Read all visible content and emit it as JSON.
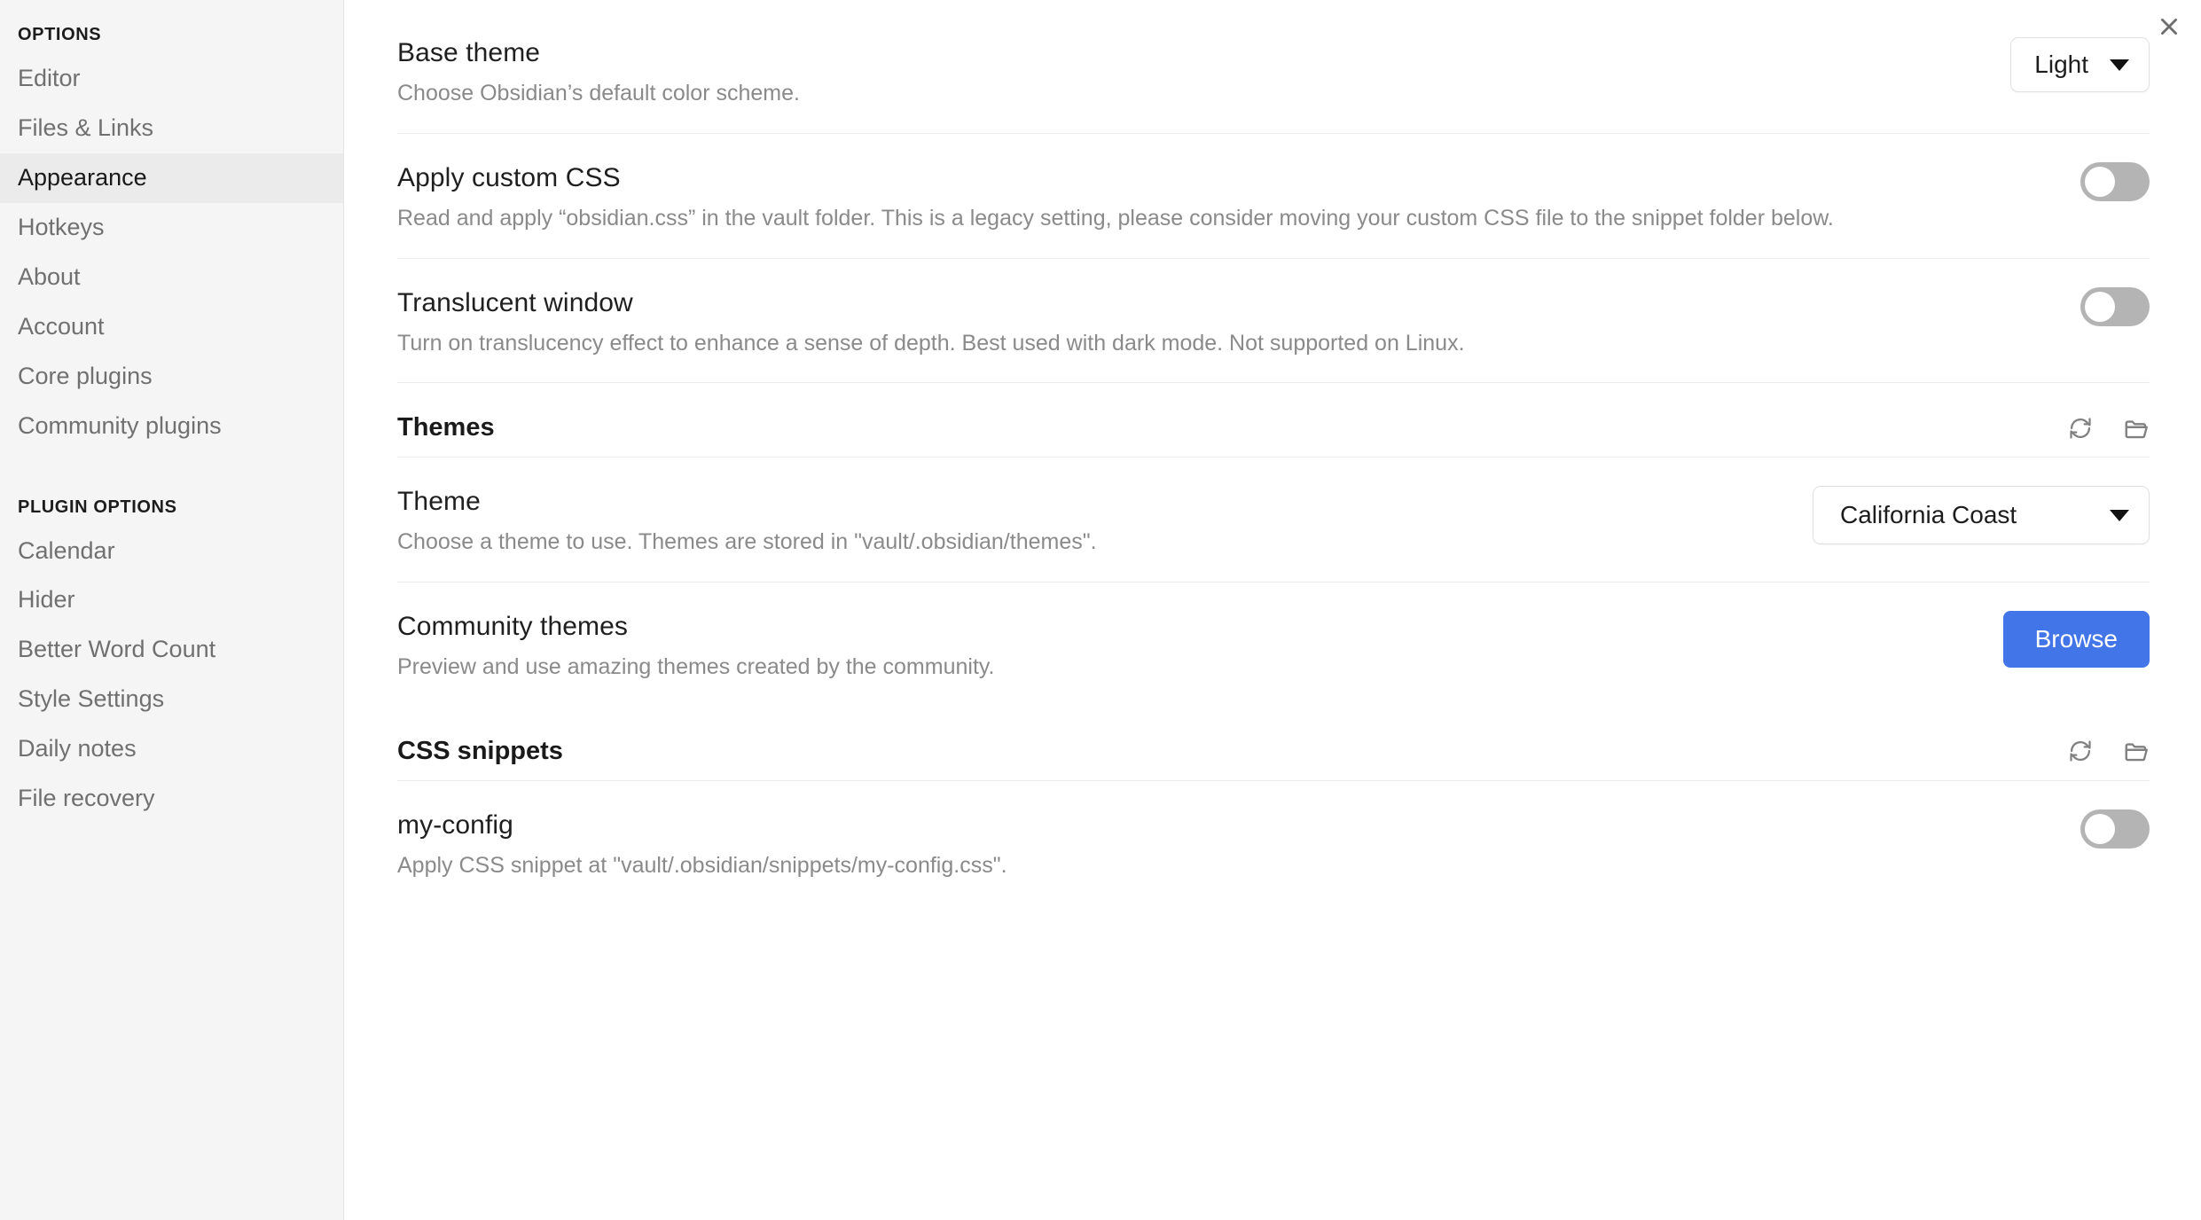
{
  "window": {
    "close_icon": "close-icon"
  },
  "sidebar": {
    "groups": [
      {
        "heading": "OPTIONS",
        "items": [
          {
            "label": "Editor",
            "active": false
          },
          {
            "label": "Files & Links",
            "active": false
          },
          {
            "label": "Appearance",
            "active": true
          },
          {
            "label": "Hotkeys",
            "active": false
          },
          {
            "label": "About",
            "active": false
          },
          {
            "label": "Account",
            "active": false
          },
          {
            "label": "Core plugins",
            "active": false
          },
          {
            "label": "Community plugins",
            "active": false
          }
        ]
      },
      {
        "heading": "PLUGIN OPTIONS",
        "items": [
          {
            "label": "Calendar",
            "active": false
          },
          {
            "label": "Hider",
            "active": false
          },
          {
            "label": "Better Word Count",
            "active": false
          },
          {
            "label": "Style Settings",
            "active": false
          },
          {
            "label": "Daily notes",
            "active": false
          },
          {
            "label": "File recovery",
            "active": false
          }
        ]
      }
    ]
  },
  "settings": {
    "base_theme": {
      "name": "Base theme",
      "desc": "Choose Obsidian’s default color scheme.",
      "value": "Light"
    },
    "apply_custom_css": {
      "name": "Apply custom CSS",
      "desc": "Read and apply “obsidian.css” in the vault folder. This is a legacy setting, please consider moving your custom CSS file to the snippet folder below.",
      "enabled": "off"
    },
    "translucent_window": {
      "name": "Translucent window",
      "desc": "Turn on translucency effect to enhance a sense of depth. Best used with dark mode. Not supported on Linux.",
      "enabled": "off"
    },
    "themes_section": {
      "title": "Themes",
      "reload_icon": "refresh-icon",
      "folder_icon": "folder-icon"
    },
    "theme": {
      "name": "Theme",
      "desc": "Choose a theme to use. Themes are stored in \"vault/.obsidian/themes\".",
      "value": "California Coast"
    },
    "community_themes": {
      "name": "Community themes",
      "desc": "Preview and use amazing themes created by the community.",
      "button_label": "Browse"
    },
    "css_snippets_section": {
      "title": "CSS snippets",
      "reload_icon": "refresh-icon",
      "folder_icon": "folder-icon"
    },
    "my_config_snippet": {
      "name": "my-config",
      "desc": "Apply CSS snippet at \"vault/.obsidian/snippets/my-config.css\".",
      "enabled": "off"
    }
  },
  "colors": {
    "accent": "#4175e8",
    "sidebar_bg": "#f5f5f5",
    "active_item_bg": "#ebebeb",
    "toggle_off": "#b4b4b4",
    "text_muted": "#8a8a8a"
  }
}
